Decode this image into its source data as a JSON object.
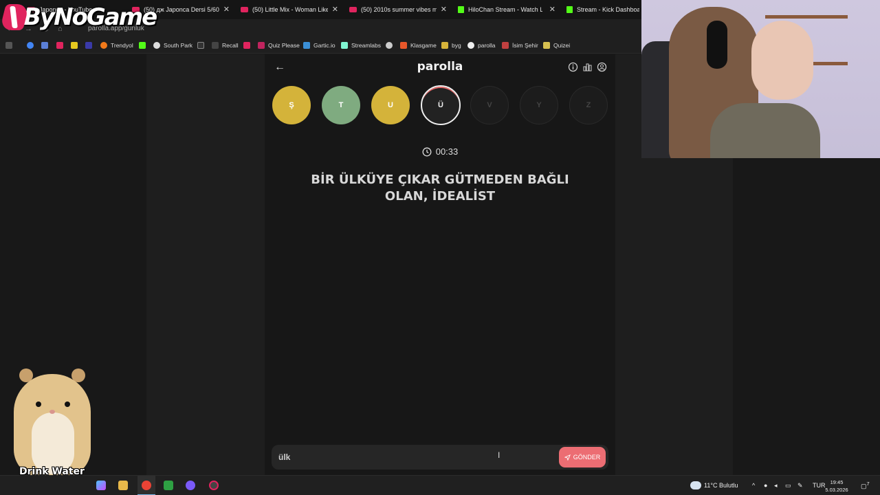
{
  "tabs": [
    {
      "label": "Japonca - YouTube"
    },
    {
      "label": "(50) дж Japonca Dersi 5/60: Japo"
    },
    {
      "label": "(50) Little Mix - Woman Like M"
    },
    {
      "label": "(50) 2010s summer vibes mix -"
    },
    {
      "label": "HiloChan Stream - Watch L"
    },
    {
      "label": "Stream - Kick Dashboard"
    }
  ],
  "address": {
    "url": "parolla.app/gunluk"
  },
  "bookmarks": [
    {
      "label": "Trendyol"
    },
    {
      "label": "South Park"
    },
    {
      "label": "Recall"
    },
    {
      "label": "Quiz Please"
    },
    {
      "label": "Gartic.io"
    },
    {
      "label": "Streamlabs"
    },
    {
      "label": "Klasgame"
    },
    {
      "label": "byg"
    },
    {
      "label": "parolla"
    },
    {
      "label": "İsim Şehir"
    },
    {
      "label": "Quizei"
    }
  ],
  "overlay": {
    "logo_text": "ByNoGame",
    "hamster_caption": "Drink Water"
  },
  "game": {
    "title": "parolla",
    "letters": [
      {
        "char": "Ş",
        "state": "correct-yellow"
      },
      {
        "char": "T",
        "state": "correct-green"
      },
      {
        "char": "U",
        "state": "correct-yellow"
      },
      {
        "char": "Ü",
        "state": "active"
      },
      {
        "char": "V",
        "state": "pending"
      },
      {
        "char": "Y",
        "state": "pending"
      },
      {
        "char": "Z",
        "state": "pending"
      }
    ],
    "timer": "00:33",
    "question_line1": "BİR ÜLKÜYE ÇIKAR GÜTMEDEN BAĞLI",
    "question_line2": "OLAN, İDEALİST",
    "answer_value": "ülk",
    "send_label": "GÖNDER"
  },
  "taskbar": {
    "weather": "11°C  Bulutlu",
    "lang": "TUR",
    "time": "19:45",
    "date": "5.03.2026",
    "notification_count": "7"
  },
  "colors": {
    "yellow": "#d4b33a",
    "green": "#7fab80",
    "accent": "#ec6d73",
    "background": "#171717"
  }
}
